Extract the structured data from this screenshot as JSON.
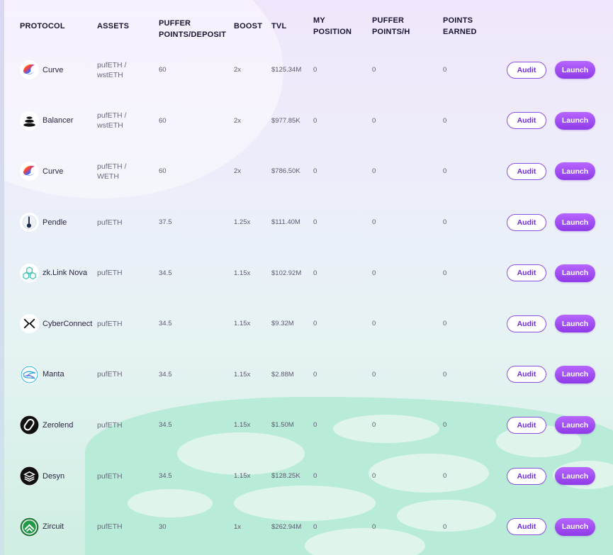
{
  "columns": {
    "protocol": "PROTOCOL",
    "assets": "ASSETS",
    "puffer_points_deposit_1": "PUFFER",
    "puffer_points_deposit_2": "POINTS/DEPOSIT",
    "boost": "BOOST",
    "tvl": "TVL",
    "my_position_1": "MY",
    "my_position_2": "POSITION",
    "puffer_points_h_1": "PUFFER",
    "puffer_points_h_2": "POINTS/H",
    "points_earned_1": "POINTS",
    "points_earned_2": "EARNED"
  },
  "buttons": {
    "audit": "Audit",
    "launch": "Launch"
  },
  "rows": [
    {
      "protocol": "Curve",
      "logo": "curve-icon",
      "assets_1": "pufETH /",
      "assets_2": "wstETH",
      "points_deposit": "60",
      "boost": "2x",
      "tvl": "$125.34M",
      "my_position": "0",
      "points_h": "0",
      "points_earned": "0"
    },
    {
      "protocol": "Balancer",
      "logo": "balancer-icon",
      "assets_1": "pufETH /",
      "assets_2": "wstETH",
      "points_deposit": "60",
      "boost": "2x",
      "tvl": "$977.85K",
      "my_position": "0",
      "points_h": "0",
      "points_earned": "0"
    },
    {
      "protocol": "Curve",
      "logo": "curve-icon",
      "assets_1": "pufETH /",
      "assets_2": "WETH",
      "points_deposit": "60",
      "boost": "2x",
      "tvl": "$786.50K",
      "my_position": "0",
      "points_h": "0",
      "points_earned": "0"
    },
    {
      "protocol": "Pendle",
      "logo": "pendle-icon",
      "assets_1": "pufETH",
      "assets_2": "",
      "points_deposit": "37.5",
      "boost": "1.25x",
      "tvl": "$111.40M",
      "my_position": "0",
      "points_h": "0",
      "points_earned": "0"
    },
    {
      "protocol": "zk.Link Nova",
      "logo": "zklink-icon",
      "assets_1": "pufETH",
      "assets_2": "",
      "points_deposit": "34.5",
      "boost": "1.15x",
      "tvl": "$102.92M",
      "my_position": "0",
      "points_h": "0",
      "points_earned": "0"
    },
    {
      "protocol": "CyberConnect",
      "logo": "cyberconnect-icon",
      "assets_1": "pufETH",
      "assets_2": "",
      "points_deposit": "34.5",
      "boost": "1.15x",
      "tvl": "$9.32M",
      "my_position": "0",
      "points_h": "0",
      "points_earned": "0"
    },
    {
      "protocol": "Manta",
      "logo": "manta-icon",
      "assets_1": "pufETH",
      "assets_2": "",
      "points_deposit": "34.5",
      "boost": "1.15x",
      "tvl": "$2.88M",
      "my_position": "0",
      "points_h": "0",
      "points_earned": "0"
    },
    {
      "protocol": "Zerolend",
      "logo": "zerolend-icon",
      "assets_1": "pufETH",
      "assets_2": "",
      "points_deposit": "34.5",
      "boost": "1.15x",
      "tvl": "$1.50M",
      "my_position": "0",
      "points_h": "0",
      "points_earned": "0"
    },
    {
      "protocol": "Desyn",
      "logo": "desyn-icon",
      "assets_1": "pufETH",
      "assets_2": "",
      "points_deposit": "34.5",
      "boost": "1.15x",
      "tvl": "$128.25K",
      "my_position": "0",
      "points_h": "0",
      "points_earned": "0"
    },
    {
      "protocol": "Zircuit",
      "logo": "zircuit-icon",
      "assets_1": "pufETH",
      "assets_2": "",
      "points_deposit": "30",
      "boost": "1x",
      "tvl": "$262.94M",
      "my_position": "0",
      "points_h": "0",
      "points_earned": "0"
    }
  ],
  "colors": {
    "accent": "#8e3ae8",
    "accent_light": "#b766ff",
    "text_dark": "#1a1433"
  }
}
